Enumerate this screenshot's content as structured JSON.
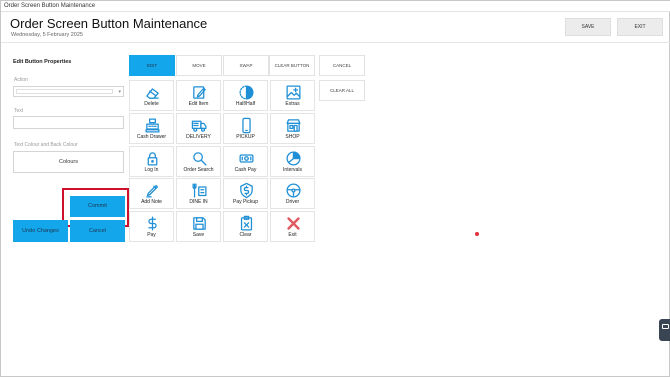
{
  "window": {
    "title": "Order Screen Button Maintenance"
  },
  "header": {
    "title": "Order Screen Button Maintenance",
    "date": "Wednesday, 5 February 2025",
    "save_label": "SAVE",
    "exit_label": "EXIT"
  },
  "properties": {
    "title": "Edit Button Properties",
    "action_label": "Action",
    "action_value": "",
    "text_label": "Text",
    "text_value": "",
    "colour_label": "Text Colour and Back Colour",
    "colours_button": "Colours",
    "commit_label": "Commit",
    "undo_label": "Undo Changes",
    "cancel_label": "Cancel"
  },
  "modes": {
    "edit": "EDIT",
    "move": "MOVE",
    "swap": "SWAP",
    "clear_button": "CLEAR BUTTON",
    "cancel": "CANCEL",
    "clear_all": "CLEAR ALL"
  },
  "tiles": [
    {
      "label": "Delete",
      "icon": "eraser-icon"
    },
    {
      "label": "Edit Item",
      "icon": "edit-icon"
    },
    {
      "label": "Half/Half",
      "icon": "half-circle-icon"
    },
    {
      "label": "Extras",
      "icon": "extras-icon"
    },
    {
      "label": "Cash Drawer",
      "icon": "cash-register-icon"
    },
    {
      "label": "DELIVERY",
      "icon": "truck-icon"
    },
    {
      "label": "PICKUP",
      "icon": "phone-icon"
    },
    {
      "label": "SHOP",
      "icon": "store-icon"
    },
    {
      "label": "Log In",
      "icon": "lock-icon"
    },
    {
      "label": "Order Search",
      "icon": "search-icon"
    },
    {
      "label": "Cash Pay",
      "icon": "money-icon"
    },
    {
      "label": "Intervals",
      "icon": "clock-icon"
    },
    {
      "label": "Add Note",
      "icon": "pen-icon"
    },
    {
      "label": "DINE IN",
      "icon": "dine-in-icon"
    },
    {
      "label": "Pay Pickup",
      "icon": "pay-pickup-icon"
    },
    {
      "label": "Driver",
      "icon": "steering-wheel-icon"
    },
    {
      "label": "Pay",
      "icon": "dollar-icon"
    },
    {
      "label": "Save",
      "icon": "floppy-icon"
    },
    {
      "label": "Clear",
      "icon": "clipboard-icon"
    },
    {
      "label": "Exit",
      "icon": "x-icon"
    }
  ],
  "colors": {
    "accent": "#13a6ea",
    "icon": "#1f8fd6",
    "highlight": "#d0102b",
    "exit": "#e05a62"
  }
}
